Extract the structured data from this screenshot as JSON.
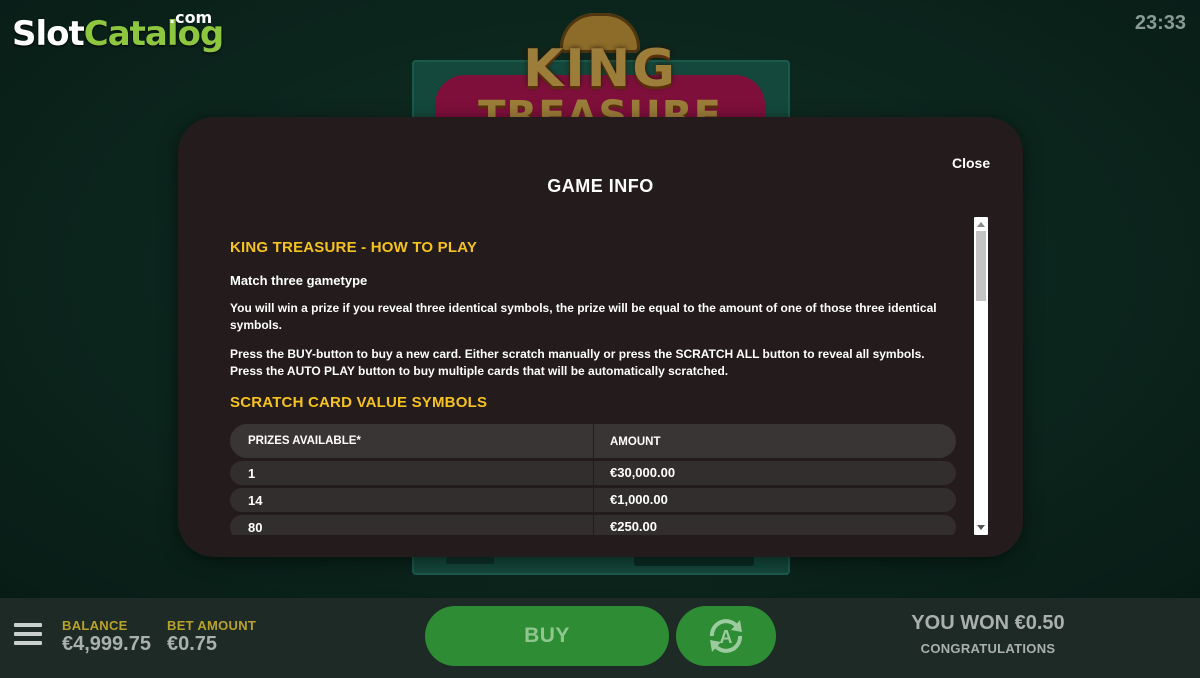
{
  "watermark": {
    "slot": "Slot",
    "catalog": "Catalog",
    "com": ".com"
  },
  "clock": "23:33",
  "background_game": {
    "logo_line1": "KING",
    "logo_line2": "TREASURE"
  },
  "modal": {
    "title": "GAME INFO",
    "close_label": "Close",
    "heading_how_to_play": "KING TREASURE - HOW TO PLAY",
    "gametype": "Match three gametype",
    "paragraph1": "You will win a prize if you reveal three identical symbols, the prize will be equal to the amount of one of those three identical symbols.",
    "paragraph2": "Press the BUY-button to buy a new card. Either scratch manually or press the SCRATCH ALL button to reveal all symbols. Press the AUTO PLAY button to buy multiple cards that will be automatically scratched.",
    "heading_value_symbols": "SCRATCH CARD VALUE SYMBOLS",
    "table": {
      "col_prizes": "PRIZES AVAILABLE*",
      "col_amount": "AMOUNT",
      "rows": [
        {
          "prizes": "1",
          "amount": "€30,000.00"
        },
        {
          "prizes": "14",
          "amount": "€1,000.00"
        },
        {
          "prizes": "80",
          "amount": "€250.00"
        }
      ]
    }
  },
  "bottombar": {
    "balance_label": "BALANCE",
    "balance_value": "€4,999.75",
    "bet_label": "BET AMOUNT",
    "bet_value": "€0.75",
    "buy_label": "BUY",
    "win_text": "YOU WON €0.50",
    "congrats_text": "CONGRATULATIONS"
  },
  "colors": {
    "accent_yellow": "#f6c21e",
    "button_green": "#2e8c34",
    "modal_bg": "#241c1c",
    "brand_green": "#8dc63f"
  }
}
